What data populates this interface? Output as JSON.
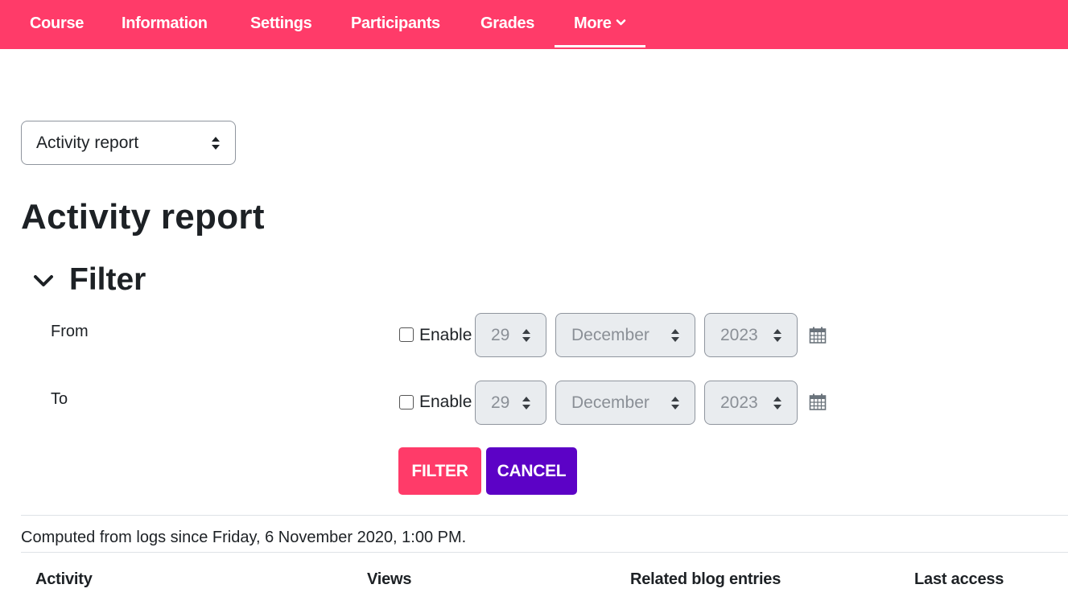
{
  "nav": {
    "items": [
      {
        "label": "Course"
      },
      {
        "label": "Information"
      },
      {
        "label": "Settings"
      },
      {
        "label": "Participants"
      },
      {
        "label": "Grades"
      },
      {
        "label": "More"
      }
    ],
    "active": "More",
    "colors": {
      "bar": "#ff3b69",
      "text": "#ffffff"
    }
  },
  "report_selector": {
    "selected": "Activity report"
  },
  "page_title": "Activity report",
  "filter": {
    "heading": "Filter",
    "from": {
      "label": "From",
      "enable_label": "Enable",
      "enabled": false,
      "day": "29",
      "month": "December",
      "year": "2023"
    },
    "to": {
      "label": "To",
      "enable_label": "Enable",
      "enabled": false,
      "day": "29",
      "month": "December",
      "year": "2023"
    },
    "filter_button": "FILTER",
    "cancel_button": "CANCEL",
    "colors": {
      "filter": "#ff3b69",
      "cancel": "#5c02c6"
    }
  },
  "computed_text": "Computed from logs since Friday, 6 November 2020, 1:00 PM.",
  "table": {
    "columns": [
      "Activity",
      "Views",
      "Related blog entries",
      "Last access"
    ]
  }
}
